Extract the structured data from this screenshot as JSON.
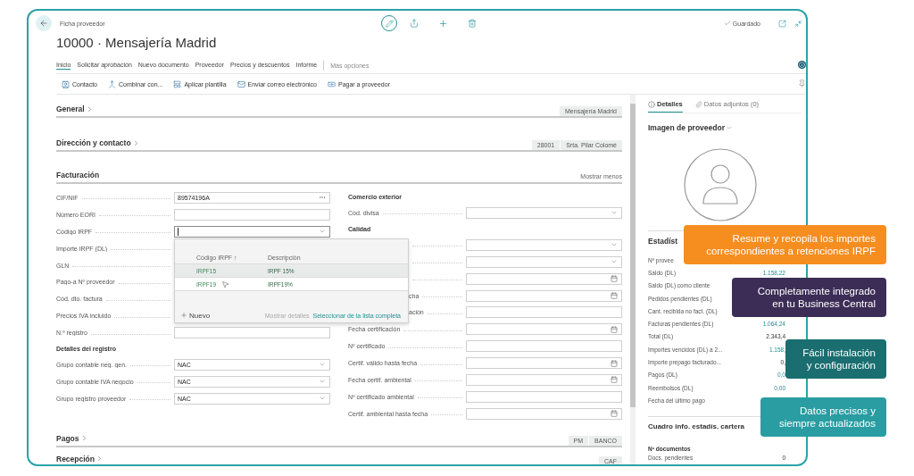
{
  "header": {
    "breadcrumb": "Ficha proveedor",
    "status": "Guardado"
  },
  "title": "10000 · Mensajería Madrid",
  "tabs": [
    {
      "label": "Inicio",
      "selected": true
    },
    {
      "label": "Solicitar aprobación",
      "selected": false
    },
    {
      "label": "Nuevo documento",
      "selected": false
    },
    {
      "label": "Proveedor",
      "selected": false
    },
    {
      "label": "Precios y descuentos",
      "selected": false
    },
    {
      "label": "Informe",
      "selected": false
    }
  ],
  "more_options": "Más opciones",
  "actions": [
    "Contacto",
    "Combinar con...",
    "Aplicar plantilla",
    "Enviar correo electrónico",
    "Pagar a proveedor"
  ],
  "sections": [
    {
      "title": "General",
      "expanded": false,
      "badges": [
        "Mensajería Madrid"
      ]
    },
    {
      "title": "Dirección y contacto",
      "expanded": false,
      "badges": [
        "28001",
        "Srta. Pilar Colomé"
      ]
    },
    {
      "title": "Facturación",
      "expanded": true,
      "link": "Mostrar menos"
    }
  ],
  "billing": {
    "left": [
      {
        "kind": "text",
        "label": "CIF/NIF",
        "value": "89574196A",
        "assist": true
      },
      {
        "kind": "text",
        "label": "Número EORI",
        "assist": false
      },
      {
        "kind": "select",
        "label": "Código IRPF",
        "focused": true
      },
      {
        "kind": "covered",
        "label": "Importe IRPF (DL)"
      },
      {
        "kind": "covered",
        "label": "GLN"
      },
      {
        "kind": "covered",
        "label": "Pago-a Nº proveedor"
      },
      {
        "kind": "covered",
        "label": "Cód. dto. factura"
      },
      {
        "kind": "covered",
        "label": "Precios IVA incluido"
      },
      {
        "kind": "text",
        "label": "N.º registro",
        "assist": false
      },
      {
        "kind": "heading",
        "label": "Detalles del registro"
      },
      {
        "kind": "select",
        "label": "Grupo contable neg. gen.",
        "value": "NAC",
        "focused": false
      },
      {
        "kind": "select",
        "label": "Grupo contable IVA negocio",
        "value": "NAC",
        "focused": false
      },
      {
        "kind": "select",
        "label": "Grupo registro proveedor",
        "value": "NAC",
        "focused": false
      }
    ],
    "right": [
      {
        "kind": "heading",
        "label": "Comercio exterior"
      },
      {
        "kind": "select",
        "label": "Cód. divisa",
        "focused": false
      },
      {
        "kind": "heading",
        "label": "Calidad"
      },
      {
        "kind": "select",
        "label_covered": true,
        "focused": false
      },
      {
        "kind": "select",
        "label_covered": true,
        "focused": false
      },
      {
        "kind": "date",
        "label_covered": true
      },
      {
        "kind": "date",
        "label": "cha",
        "label_covered": true
      },
      {
        "kind": "text",
        "label": "ación",
        "label_covered": true,
        "assist": false
      },
      {
        "kind": "date",
        "label": "Fecha certificación"
      },
      {
        "kind": "text",
        "label": "Nº certificado",
        "assist": false
      },
      {
        "kind": "date",
        "label": "Certif. válido hasta fecha"
      },
      {
        "kind": "date",
        "label": "Fecha certif. ambiental"
      },
      {
        "kind": "text",
        "label": "Nº certificado ambiental",
        "assist": false
      },
      {
        "kind": "date",
        "label": "Certif. ambiental hasta fecha"
      }
    ],
    "lookup": {
      "columns": [
        "Código IRPF ↑",
        "Descripción"
      ],
      "rows": [
        {
          "code": "IRPF15",
          "description": "IRPF 15%",
          "selected": true,
          "hovered": false
        },
        {
          "code": "IRPF19",
          "description": "IRPF19%",
          "selected": false,
          "hovered": true
        }
      ],
      "new": "Nuevo",
      "details": "Mostrar detalles",
      "details_disabled": true,
      "full_list": "Seleccionar de la lista completa"
    }
  },
  "lower_sections": [
    {
      "title": "Pagos",
      "expanded": false,
      "badges": [
        "PM",
        "BANCO"
      ]
    },
    {
      "title": "Recepción",
      "expanded": false,
      "badges": [
        "CAF"
      ]
    }
  ],
  "factbox": {
    "tabs": [
      {
        "label": "Detalles",
        "selected": true
      },
      {
        "label": "Datos adjuntos (0)",
        "selected": false
      }
    ],
    "picture_title": "Imagen de proveedor",
    "stats_title": "Estadíst",
    "stats": [
      {
        "label": "Nº provee"
      },
      {
        "label": "Saldo (DL)",
        "value": "1.158,22",
        "link": true
      },
      {
        "label": "Saldo (DL) como cliente"
      },
      {
        "label": "Pedidos pendientes (DL)"
      },
      {
        "label": "Cant. recibida no fact. (DL)"
      },
      {
        "label": "Facturas pendientes (DL)",
        "value": "1.064,24",
        "link": true
      },
      {
        "label": "Total (DL)",
        "value": "2.343,4",
        "link": false
      },
      {
        "label": "Importes vencidos (DL) a 2...",
        "value": "1.158,",
        "link": true
      },
      {
        "label": "Importe prepago facturado...",
        "value": "0,",
        "link": false
      },
      {
        "label": "Pagos (DL)",
        "value": "0,0",
        "link": true
      },
      {
        "label": "Reembolsos (DL)",
        "value": "0,00",
        "link": true
      },
      {
        "label": "Fecha del último pago"
      }
    ],
    "portfolio_title": "Cuadro info. estadís. cartera",
    "docs_heading": "Nº documentos",
    "docs": [
      {
        "label": "Docs. pendientes",
        "value": "0"
      }
    ]
  },
  "callouts": [
    {
      "text": "Resume y recopila los importes\ncorrespondientes a retenciones IRPF",
      "color": "#f68d1f"
    },
    {
      "text": "Completamente integrado\nen tu Business Central",
      "color": "#3b2d55"
    },
    {
      "text": "Fácil instalación\ny configuración",
      "color": "#1a6e70"
    },
    {
      "text": "Datos precisos y\nsiempre actualizados",
      "color": "#2a9da2"
    }
  ]
}
